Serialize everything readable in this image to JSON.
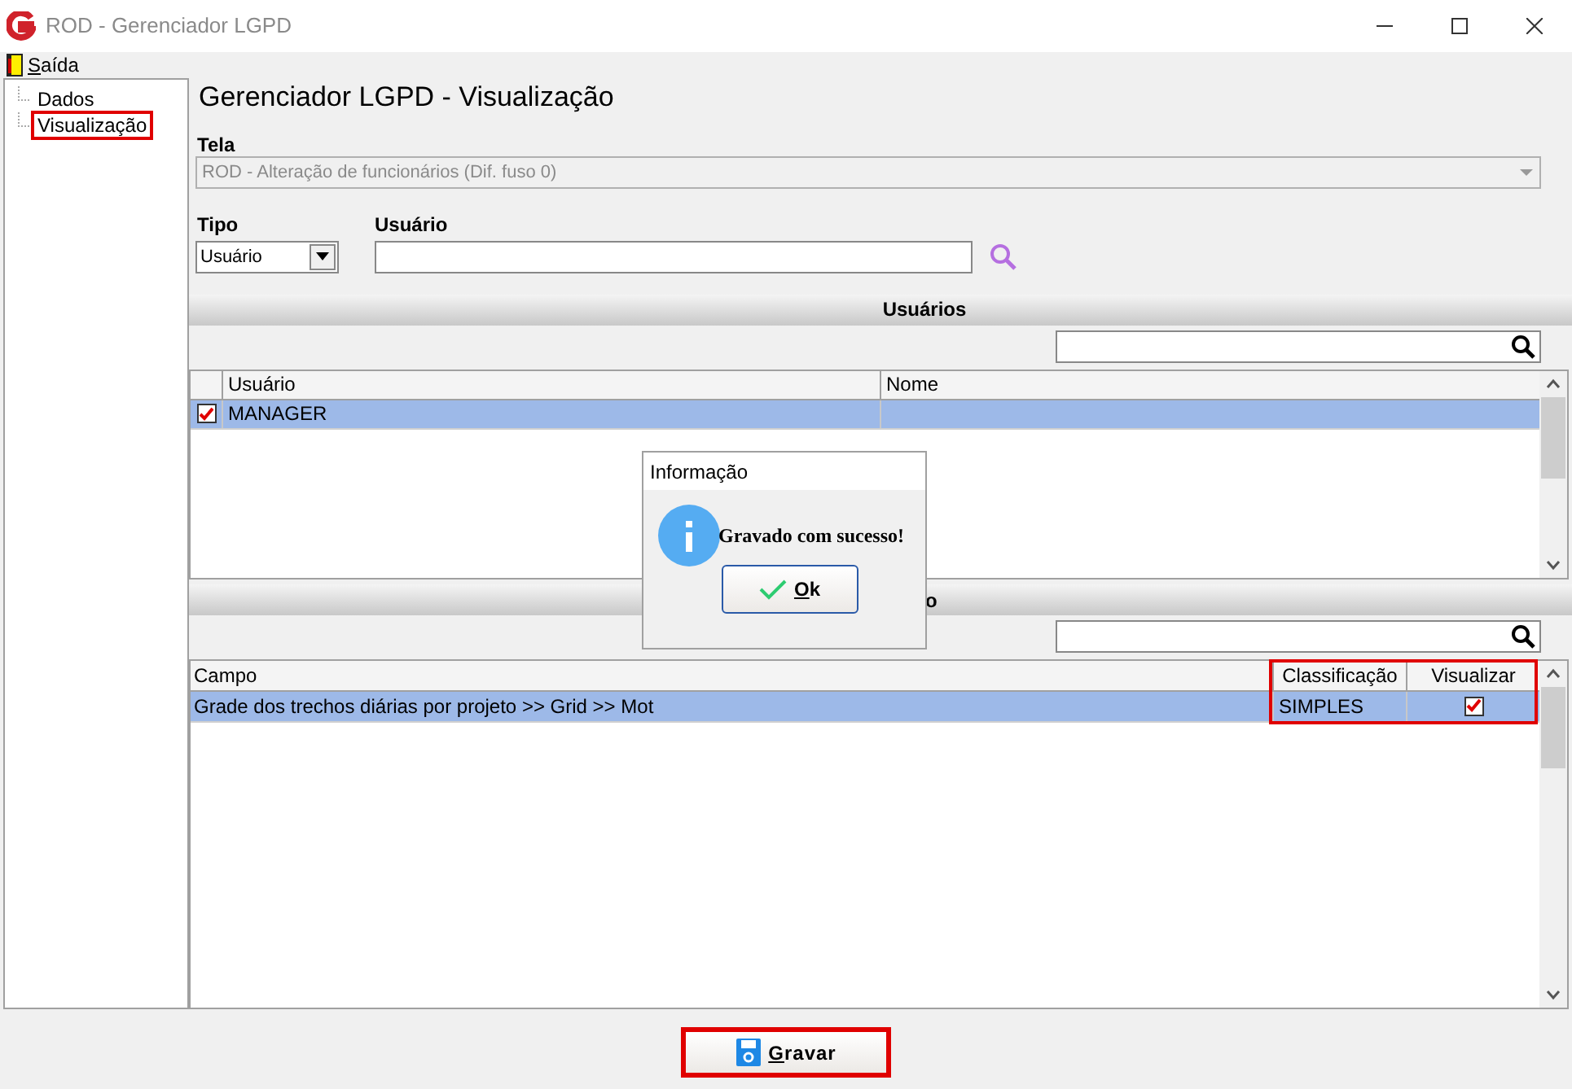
{
  "window": {
    "title": "ROD - Gerenciador LGPD"
  },
  "menu": [
    {
      "label": "Saída"
    }
  ],
  "tree": [
    {
      "label": "Dados",
      "highlighted": false
    },
    {
      "label": "Visualização",
      "highlighted": true
    }
  ],
  "heading": "Gerenciador LGPD - Visualização",
  "tela": {
    "label": "Tela",
    "value": "ROD - Alteração de funcionários (Dif. fuso 0)",
    "disabled": true
  },
  "tipo": {
    "label": "Tipo",
    "value": "Usuário"
  },
  "usuario": {
    "label": "Usuário"
  },
  "users_section": {
    "title": "Usuários",
    "columns": [
      {
        "label": "Usuário"
      },
      {
        "label": "Nome"
      }
    ],
    "rows": [
      {
        "checked": true,
        "selected": true,
        "cells": [
          "MANAGER",
          ""
        ]
      }
    ]
  },
  "fields_section": {
    "title": "o",
    "highlight_frame": true,
    "columns": [
      {
        "label": "Campo"
      },
      {
        "label": "Classificação"
      },
      {
        "label": "Visualizar"
      }
    ],
    "rows": [
      {
        "selected": true,
        "campo": "Grade dos trechos diárias por projeto >> Grid >> Mot",
        "classificacao": "SIMPLES",
        "visualizar": true
      }
    ]
  },
  "dialog": {
    "title": "Informação",
    "message": "Gravado com sucesso!",
    "button": "Ok"
  },
  "save_button": {
    "label": "Gravar",
    "highlighted": true
  }
}
